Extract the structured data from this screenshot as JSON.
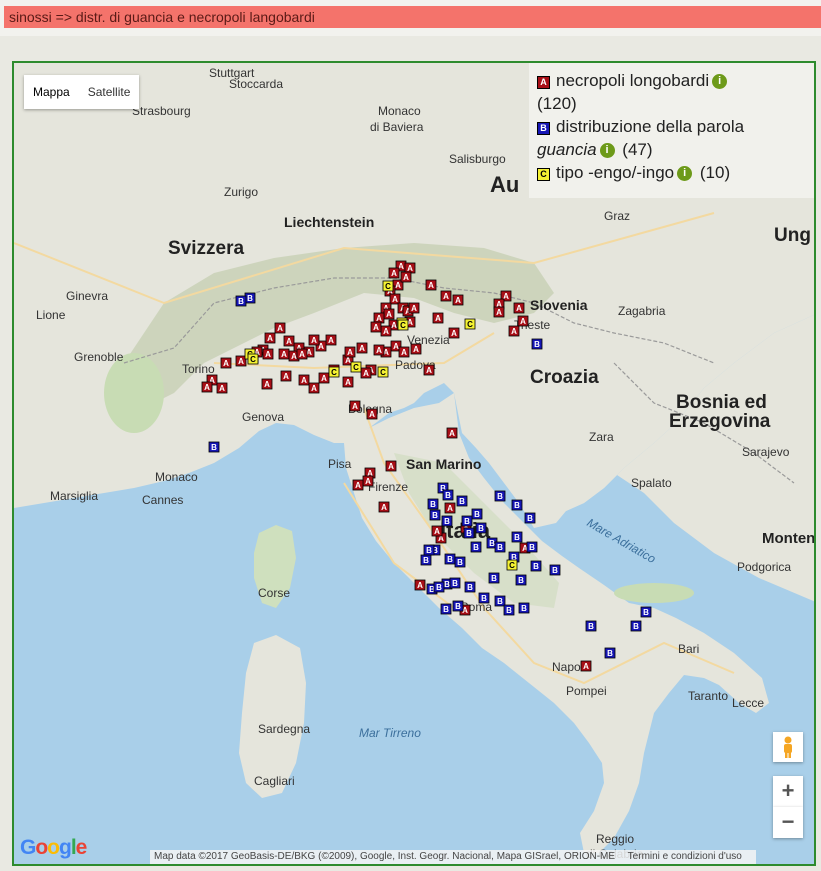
{
  "header": {
    "title": "sinossi => distr. di guancia e necropoli langobardi"
  },
  "map_type": {
    "map": "Mappa",
    "satellite": "Satellite"
  },
  "legend": {
    "items": [
      {
        "letter": "A",
        "label": "necropoli longobardi",
        "count": "(120)"
      },
      {
        "letter": "B",
        "label_pre": "distribuzione della parola ",
        "label_em": "guancia",
        "count": "(47)"
      },
      {
        "letter": "C",
        "label": "tipo -engo/-ingo",
        "count": "(10)"
      }
    ]
  },
  "zoom": {
    "in": "+",
    "out": "−"
  },
  "attribution": {
    "data": "Map data ©2017 GeoBasis-DE/BKG (©2009), Google, Inst. Geogr. Nacional, Mapa GISrael, ORION-ME",
    "terms": "Termini e condizioni d'uso"
  },
  "logo": "Google",
  "place_labels": {
    "stuttgart": "Stuttgart",
    "stoccarda": "Stoccarda",
    "strasbourg": "Strasbourg",
    "monaco_baviera": "Monaco\ndi Baviera",
    "salisburgo": "Salisburgo",
    "au": "Au",
    "zurigo": "Zurigo",
    "liechtenstein": "Liechtenstein",
    "svizzera": "Svizzera",
    "graz": "Graz",
    "ung": "Ung",
    "ginevra": "Ginevra",
    "lione": "Lione",
    "slovenia": "Slovenia",
    "zagabria": "Zagabria",
    "trieste": "Trieste",
    "venezia": "Venezia",
    "grenoble": "Grenoble",
    "torino": "Torino",
    "padova": "Padova",
    "croazia": "Croazia",
    "bosnia": "Bosnia ed\nErzegovina",
    "genova": "Genova",
    "bologna": "Bologna",
    "zara": "Zara",
    "sarajevo": "Sarajevo",
    "monaco": "Monaco",
    "san_marino": "San Marino",
    "marsiglia": "Marsiglia",
    "cannes": "Cannes",
    "pisa": "Pisa",
    "firenze": "Firenze",
    "spalato": "Spalato",
    "mare_adriatico": "Mare Adriatico",
    "monten": "Monten",
    "podgorica": "Podgorica",
    "corse": "Corse",
    "italia": "Italia",
    "roma": "Roma",
    "bari": "Bari",
    "napoli": "Napoli",
    "pompei": "Pompei",
    "taranto": "Taranto",
    "lecce": "Lecce",
    "sardegna": "Sardegna",
    "mar_tirreno": "Mar Tirreno",
    "cagliari": "Cagliari",
    "reggio": "Reggio\ndi Calabria"
  },
  "markers": {
    "A": [
      [
        387,
        203
      ],
      [
        380,
        210
      ],
      [
        396,
        205
      ],
      [
        384,
        222
      ],
      [
        392,
        214
      ],
      [
        376,
        228
      ],
      [
        381,
        236
      ],
      [
        389,
        245
      ],
      [
        372,
        245
      ],
      [
        375,
        251
      ],
      [
        365,
        255
      ],
      [
        394,
        248
      ],
      [
        400,
        245
      ],
      [
        380,
        262
      ],
      [
        372,
        268
      ],
      [
        362,
        264
      ],
      [
        396,
        259
      ],
      [
        382,
        283
      ],
      [
        372,
        289
      ],
      [
        390,
        289
      ],
      [
        402,
        286
      ],
      [
        365,
        287
      ],
      [
        334,
        297
      ],
      [
        348,
        285
      ],
      [
        336,
        289
      ],
      [
        317,
        277
      ],
      [
        307,
        283
      ],
      [
        300,
        277
      ],
      [
        295,
        289
      ],
      [
        285,
        285
      ],
      [
        275,
        278
      ],
      [
        266,
        265
      ],
      [
        256,
        275
      ],
      [
        249,
        287
      ],
      [
        239,
        295
      ],
      [
        227,
        298
      ],
      [
        212,
        300
      ],
      [
        198,
        317
      ],
      [
        193,
        324
      ],
      [
        208,
        325
      ],
      [
        243,
        289
      ],
      [
        254,
        291
      ],
      [
        270,
        291
      ],
      [
        280,
        293
      ],
      [
        288,
        291
      ],
      [
        253,
        321
      ],
      [
        272,
        313
      ],
      [
        290,
        317
      ],
      [
        310,
        315
      ],
      [
        300,
        325
      ],
      [
        320,
        307
      ],
      [
        334,
        319
      ],
      [
        341,
        343
      ],
      [
        358,
        351
      ],
      [
        357,
        307
      ],
      [
        352,
        310
      ],
      [
        417,
        222
      ],
      [
        432,
        233
      ],
      [
        444,
        237
      ],
      [
        424,
        255
      ],
      [
        440,
        270
      ],
      [
        492,
        233
      ],
      [
        485,
        241
      ],
      [
        485,
        249
      ],
      [
        505,
        245
      ],
      [
        509,
        258
      ],
      [
        500,
        268
      ],
      [
        438,
        370
      ],
      [
        377,
        403
      ],
      [
        356,
        410
      ],
      [
        354,
        418
      ],
      [
        344,
        422
      ],
      [
        370,
        444
      ],
      [
        415,
        307
      ],
      [
        436,
        445
      ],
      [
        452,
        465
      ],
      [
        427,
        475
      ],
      [
        423,
        468
      ],
      [
        406,
        522
      ],
      [
        451,
        547
      ],
      [
        511,
        485
      ],
      [
        572,
        603
      ]
    ],
    "B": [
      [
        236,
        235
      ],
      [
        227,
        238
      ],
      [
        200,
        384
      ],
      [
        523,
        281
      ],
      [
        429,
        425
      ],
      [
        434,
        432
      ],
      [
        448,
        438
      ],
      [
        463,
        451
      ],
      [
        486,
        433
      ],
      [
        503,
        442
      ],
      [
        516,
        455
      ],
      [
        419,
        441
      ],
      [
        421,
        452
      ],
      [
        433,
        458
      ],
      [
        453,
        458
      ],
      [
        467,
        465
      ],
      [
        455,
        470
      ],
      [
        462,
        484
      ],
      [
        478,
        480
      ],
      [
        486,
        484
      ],
      [
        503,
        474
      ],
      [
        518,
        484
      ],
      [
        500,
        494
      ],
      [
        522,
        503
      ],
      [
        541,
        507
      ],
      [
        507,
        517
      ],
      [
        480,
        515
      ],
      [
        470,
        535
      ],
      [
        486,
        538
      ],
      [
        421,
        487
      ],
      [
        412,
        497
      ],
      [
        436,
        496
      ],
      [
        446,
        499
      ],
      [
        433,
        521
      ],
      [
        418,
        526
      ],
      [
        441,
        520
      ],
      [
        456,
        524
      ],
      [
        415,
        487
      ],
      [
        425,
        524
      ],
      [
        444,
        543
      ],
      [
        432,
        546
      ],
      [
        495,
        547
      ],
      [
        510,
        545
      ],
      [
        577,
        563
      ],
      [
        622,
        563
      ],
      [
        596,
        590
      ],
      [
        632,
        549
      ]
    ],
    "C": [
      [
        374,
        223
      ],
      [
        388,
        260
      ],
      [
        456,
        261
      ],
      [
        236,
        291
      ],
      [
        239,
        296
      ],
      [
        320,
        309
      ],
      [
        342,
        304
      ],
      [
        369,
        309
      ],
      [
        389,
        262
      ],
      [
        498,
        502
      ]
    ]
  }
}
